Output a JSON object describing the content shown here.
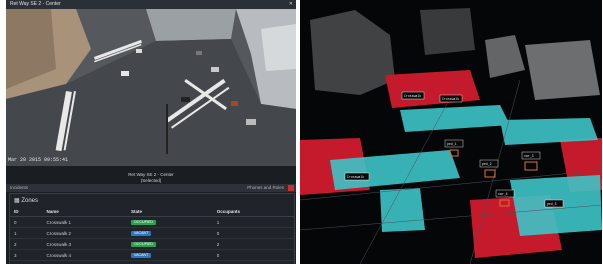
{
  "left_panel": {
    "title": "Ret Way SE 2 - Center",
    "timestamp": "Mar 20 2015 09:55:41",
    "camera_label_1": "Ret Way SE 2 - Center",
    "camera_label_2": "(Selected)",
    "zones_bar_left": "Incidents",
    "zones_bar_right": "Phones and Roles",
    "zones_title": "Zones",
    "table_headers": [
      "ID",
      "Name",
      "State",
      "Occupants"
    ],
    "table_rows": [
      {
        "id": "0",
        "name": "Crosswalk 1",
        "state": "OCCUPIED",
        "state_color": "#2e9e4f",
        "occupants": "1"
      },
      {
        "id": "1",
        "name": "Crosswalk 2",
        "state": "VACANT",
        "state_color": "#2a78c2",
        "occupants": "0"
      },
      {
        "id": "2",
        "name": "Crosswalk 3",
        "state": "OCCUPIED",
        "state_color": "#2e9e4f",
        "occupants": "2"
      },
      {
        "id": "3",
        "name": "Crosswalk 4",
        "state": "VACANT",
        "state_color": "#2a78c2",
        "occupants": "0"
      }
    ]
  },
  "right_panel": {
    "colors": {
      "zone_red": "#c41a2c",
      "zone_cyan": "#3ec4c8",
      "track_orange": "#e0702e",
      "points": "#d8dadc"
    },
    "tags": [
      "Crosswalk",
      "Crosswalk",
      "ped_1",
      "ped_2",
      "car_3",
      "car_4",
      "Crosswalk",
      "ped_5"
    ]
  }
}
